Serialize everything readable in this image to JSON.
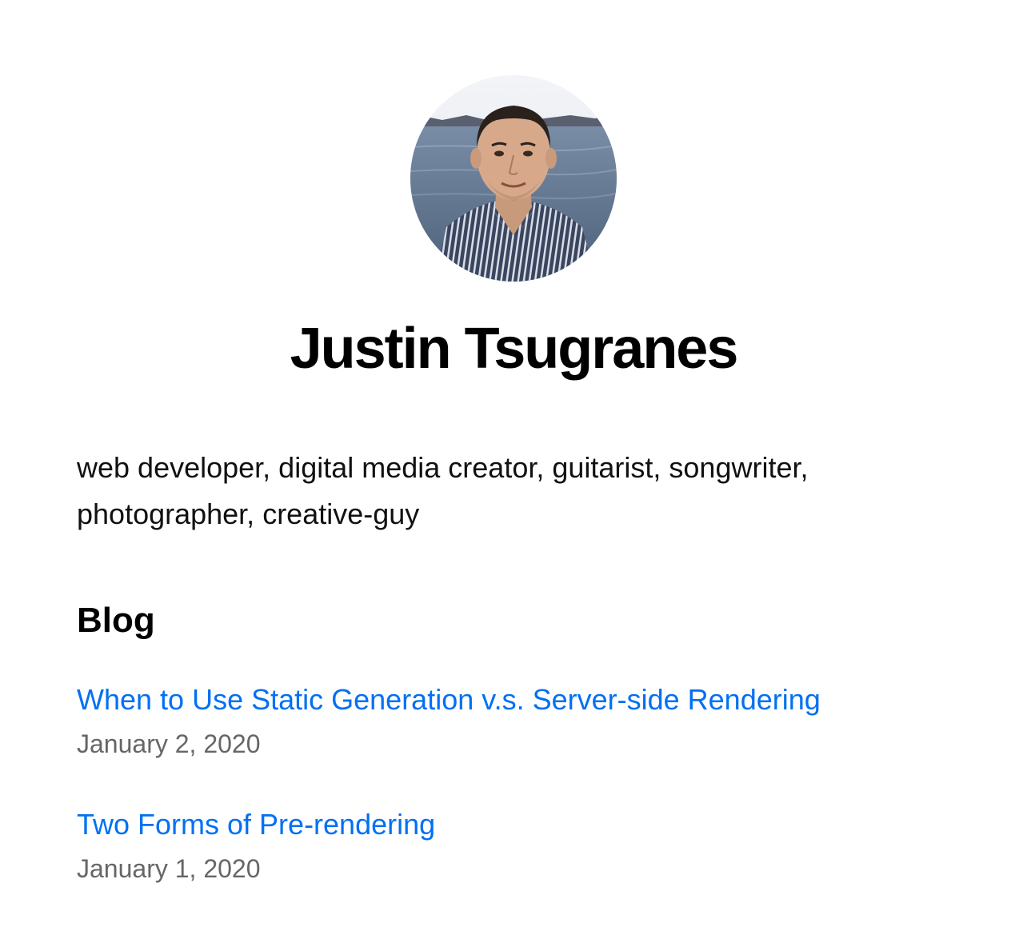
{
  "profile": {
    "name": "Justin Tsugranes",
    "bio": "web developer, digital media creator, guitarist, songwriter, photographer, creative-guy",
    "avatar_icon": "profile-photo"
  },
  "blog": {
    "heading": "Blog",
    "posts": [
      {
        "title": "When to Use Static Generation v.s. Server-side Rendering",
        "date": "January 2, 2020"
      },
      {
        "title": "Two Forms of Pre-rendering",
        "date": "January 1, 2020"
      }
    ]
  },
  "colors": {
    "link": "#0070f3",
    "date": "#666666",
    "text": "#000000",
    "background": "#ffffff"
  }
}
